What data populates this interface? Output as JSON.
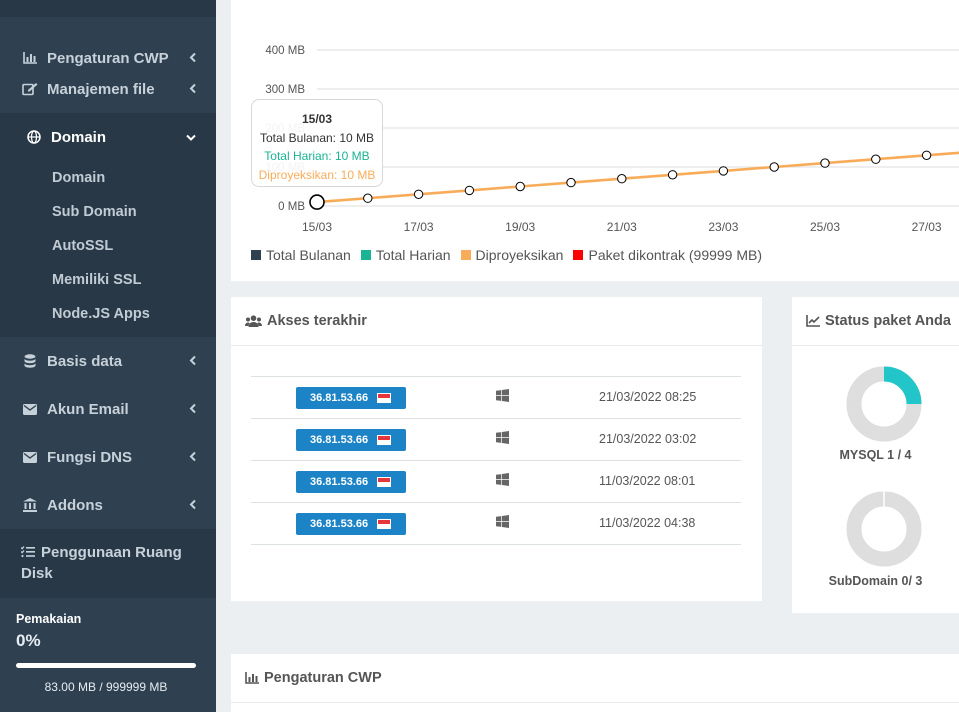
{
  "sidebar": {
    "items": [
      {
        "label": "Pengaturan CWP",
        "icon": "bar-chart-icon"
      },
      {
        "label": "Manajemen file",
        "icon": "edit-icon"
      },
      {
        "label": "Domain",
        "icon": "globe-icon"
      },
      {
        "label": "Basis data",
        "icon": "database-icon"
      },
      {
        "label": "Akun Email",
        "icon": "envelope-icon"
      },
      {
        "label": "Fungsi DNS",
        "icon": "envelope-icon"
      },
      {
        "label": "Addons",
        "icon": "bank-icon"
      },
      {
        "label": "Penggunaan Ruang Disk",
        "icon": "tasks-icon"
      }
    ],
    "domain_submenu": [
      "Domain",
      "Sub Domain",
      "AutoSSL",
      "Memiliki SSL",
      "Node.JS Apps"
    ],
    "usage": {
      "label": "Pemakaian",
      "percent_text": "0%",
      "fill_fraction": 0.0,
      "size_text": "83.00 MB / 999999 MB"
    }
  },
  "chart_data": {
    "type": "line",
    "x": [
      "15/03",
      "16/03",
      "17/03",
      "18/03",
      "19/03",
      "20/03",
      "21/03",
      "22/03",
      "23/03",
      "24/03",
      "25/03",
      "26/03",
      "27/03"
    ],
    "x_tick_labels": [
      "15/03",
      "17/03",
      "19/03",
      "21/03",
      "23/03",
      "25/03",
      "27/03"
    ],
    "series": [
      {
        "name": "Diproyeksikan",
        "color": "#f8ac59",
        "values": [
          10,
          20,
          30,
          40,
          50,
          60,
          70,
          80,
          90,
          100,
          110,
          120,
          130
        ]
      }
    ],
    "y_tick_labels": [
      "0 MB",
      "100 MB",
      "200 MB",
      "300 MB",
      "400 MB"
    ],
    "ylim": [
      0,
      400
    ],
    "legend": [
      {
        "name": "Total Bulanan",
        "color": "#2f4050"
      },
      {
        "name": "Total Harian",
        "color": "#1ab394"
      },
      {
        "name": "Diproyeksikan",
        "color": "#f8ac59"
      },
      {
        "name": "Paket dikontrak (99999 MB)",
        "color": "#ff0000"
      }
    ],
    "legend_position": "bottom-left",
    "tooltip": {
      "title": "15/03",
      "lines": [
        {
          "text": "Total Bulanan: 10 MB",
          "color": "#333333"
        },
        {
          "text": "Total Harian: 10 MB",
          "color": "#1ab394"
        },
        {
          "text": "Diproyeksikan: 10 MB",
          "color": "#f8ac59"
        }
      ]
    }
  },
  "recent_access": {
    "title": "Akses terakhir",
    "rows": [
      {
        "ip": "36.81.53.66",
        "os": "windows-icon",
        "datetime": "21/03/2022 08:25"
      },
      {
        "ip": "36.81.53.66",
        "os": "windows-icon",
        "datetime": "21/03/2022 03:02"
      },
      {
        "ip": "36.81.53.66",
        "os": "windows-icon",
        "datetime": "11/03/2022 08:01"
      },
      {
        "ip": "36.81.53.66",
        "os": "windows-icon",
        "datetime": "11/03/2022 04:38"
      }
    ]
  },
  "package_status": {
    "title": "Status paket Anda",
    "items": [
      {
        "label": "MYSQL 1 / 4",
        "fraction": 0.25,
        "color": "#23c6c8"
      },
      {
        "label": "SubDomain 0/ 3",
        "fraction": 0.0,
        "color": "#23c6c8"
      }
    ]
  },
  "cwp_panel": {
    "title": "Pengaturan CWP"
  }
}
